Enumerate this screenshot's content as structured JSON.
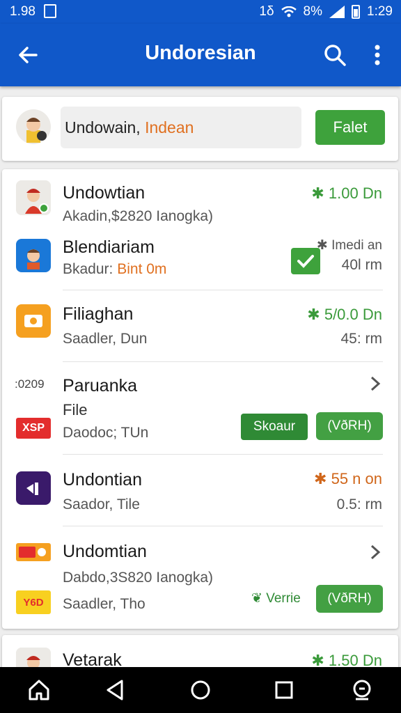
{
  "status_bar": {
    "time_left": "1.98",
    "battery_pct": "8%",
    "time_right": "1:29",
    "network": "1δ"
  },
  "app_bar": {
    "title": "Undoresian"
  },
  "search": {
    "text_main": "Undowain,",
    "text_accent": "Indean",
    "filter_label": "Falet"
  },
  "items": [
    {
      "primary": "Undowtian",
      "secondary": "Akadin,$2820 Ianogka)",
      "amount": "✱ 1.00 Dn"
    },
    {
      "primary": "Blendiariam",
      "secondary_main": "Bkadur:",
      "secondary_accent": "Bint 0m",
      "amount": "✱ Imedi an",
      "meta": "40l rm"
    },
    {
      "primary": "Filiaghan",
      "secondary": "Saadler, Dun",
      "amount": "✱ 5/0.0 Dn",
      "meta": "45: rm"
    },
    {
      "side_label_top": ":0209",
      "primary": "Paruanka",
      "primary2": "File",
      "side_label_bottom": "XSP",
      "secondary": "Daodoc; TUn",
      "button_green": "Skoaur",
      "button_outline": "(VðRH)"
    },
    {
      "primary": "Undontian",
      "secondary": "Saador, Tile",
      "amount": "✱ 55 n on",
      "meta": "0.5: rm"
    },
    {
      "primary": "Undomtian",
      "secondary": "Dabdo,3S820 Ianogka)",
      "secondary2": "Saadler, Tho",
      "tile_bottom_label": "Y6D",
      "verified_label": "Verrie",
      "button_outline": "(VðRH)"
    }
  ],
  "bottom_item": {
    "primary": "Vetarak",
    "amount": "✱ 1.50 Dn"
  },
  "colors": {
    "primary_blue": "#1058c9",
    "accent_green": "#3ea23c",
    "accent_orange": "#e07020"
  }
}
